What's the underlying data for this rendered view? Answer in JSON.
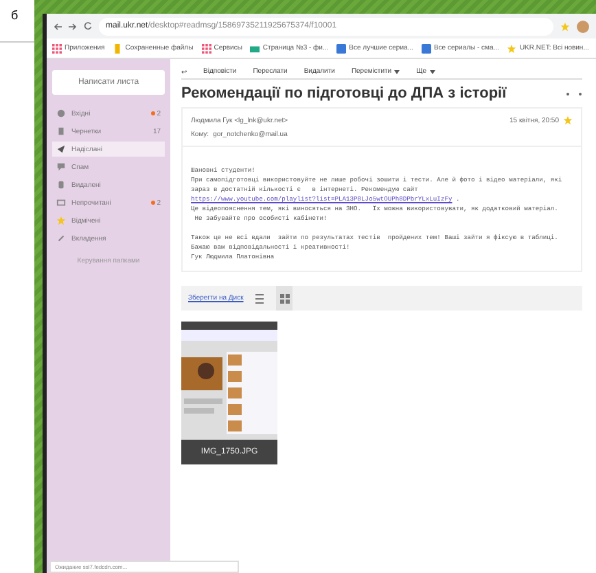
{
  "side_text": "б",
  "browser": {
    "url_host": "mail.ukr.net",
    "url_path": "/desktop#readmsg/15869735211925675374/f10001",
    "bookmarks": [
      {
        "label": "Приложения",
        "kind": "apps"
      },
      {
        "label": "Сохраненные файлы",
        "kind": "file"
      },
      {
        "label": "Сервисы",
        "kind": "apps"
      },
      {
        "label": "Страница №3 - фи...",
        "kind": "mail"
      },
      {
        "label": "Все лучшие сериа...",
        "kind": "page"
      },
      {
        "label": "Все сериалы - сма...",
        "kind": "page"
      },
      {
        "label": "UKR.NET: Всі новин...",
        "kind": "star"
      }
    ]
  },
  "sidebar": {
    "compose": "Написати листа",
    "folders": [
      {
        "label": "Вхідні",
        "count": "2",
        "dot": true,
        "selected": false,
        "kind": "inbox"
      },
      {
        "label": "Чернетки",
        "count": "17",
        "dot": false,
        "selected": false,
        "kind": "draft"
      },
      {
        "label": "Надіслані",
        "selected": true,
        "kind": "sent"
      },
      {
        "label": "Спам",
        "selected": false,
        "kind": "spam"
      },
      {
        "label": "Видалені",
        "selected": false,
        "kind": "trash"
      },
      {
        "label": "Непрочитані",
        "count": "2",
        "dot": true,
        "selected": false,
        "kind": "unread"
      },
      {
        "label": "Відмічені",
        "selected": false,
        "kind": "star"
      },
      {
        "label": "Вкладення",
        "selected": false,
        "kind": "clip"
      }
    ],
    "manage": "Керування папками"
  },
  "toolbar": {
    "back": "↩",
    "actions": [
      {
        "label": "Відповісти",
        "menu": false
      },
      {
        "label": "Переслати",
        "menu": false
      },
      {
        "label": "Видалити",
        "menu": false
      },
      {
        "label": "Перемістити",
        "menu": true
      },
      {
        "label": "Ще",
        "menu": true
      }
    ]
  },
  "message": {
    "subject": "Рекомендації по підготовці до ДПА з історії",
    "from": "Людмила Гук <lg_lnk@ukr.net>",
    "to_label": "Кому:",
    "to": "gor_notchenko@mail.ua",
    "date": "15 квітня, 20:50",
    "body": [
      {
        "kind": "text",
        "text": "Шановні студенти!"
      },
      {
        "kind": "text",
        "text": "При самопідготовці використовуйте не лише робочі зошити і тести. Але й фото і відео матеріали, які зараз в достатній кількості є   в інтернеті. Рекомендую сайт"
      },
      {
        "kind": "link",
        "text": "https://www.youtube.com/playlist?list=PLA13P8LJo5wtOUPh8DPbrYLxLuIzFy",
        "after": " ."
      },
      {
        "kind": "text",
        "text": "Це відеопояснення тем, які виносяться на ЗНО.   Їх можна використовувати, як додатковий матеріал."
      },
      {
        "kind": "text",
        "text": " Не забувайте про особисті кабінети!"
      },
      {
        "kind": "gap"
      },
      {
        "kind": "text",
        "text": "Також це не всі вдали  зайти по результатах тестів  пройдених тем! Ваші зайти я фіксую в таблиці."
      },
      {
        "kind": "text",
        "text": "Бажаю вам відповідальності і креативності!"
      },
      {
        "kind": "text",
        "text": "Гук Людмила Платонівна"
      }
    ],
    "save_link": "Зберегти на Диск",
    "views": [
      {
        "kind": "list",
        "selected": false
      },
      {
        "kind": "grid",
        "selected": true
      }
    ],
    "attachment": {
      "name": "IMG_1750.JPG",
      "kind": "picture"
    }
  },
  "status": "Ожидание ssl7.fedcdn.com..."
}
